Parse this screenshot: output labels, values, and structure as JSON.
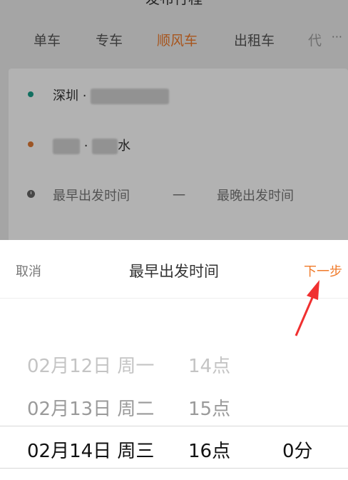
{
  "header": {
    "title": "发布行程"
  },
  "tabs": [
    {
      "label": "单车"
    },
    {
      "label": "专车"
    },
    {
      "label": "顺风车",
      "active": true
    },
    {
      "label": "出租车"
    },
    {
      "label": "代"
    }
  ],
  "trip": {
    "from": {
      "city": "深圳 ·"
    },
    "to": {
      "suffix": "水"
    },
    "time": {
      "earliest": "最早出发时间",
      "dash": "一",
      "latest": "最晚出发时间"
    }
  },
  "picker": {
    "cancel": "取消",
    "title": "最早出发时间",
    "next": "下一步",
    "rows": [
      {
        "date": "02月12日 周一",
        "hour": "14点",
        "minute": ""
      },
      {
        "date": "02月13日 周二",
        "hour": "15点",
        "minute": ""
      },
      {
        "date": "02月14日 周三",
        "hour": "16点",
        "minute": "0分"
      }
    ]
  },
  "colors": {
    "accent": "#f07a2a",
    "start_dot": "#1aa08a",
    "end_dot": "#e07a35"
  }
}
